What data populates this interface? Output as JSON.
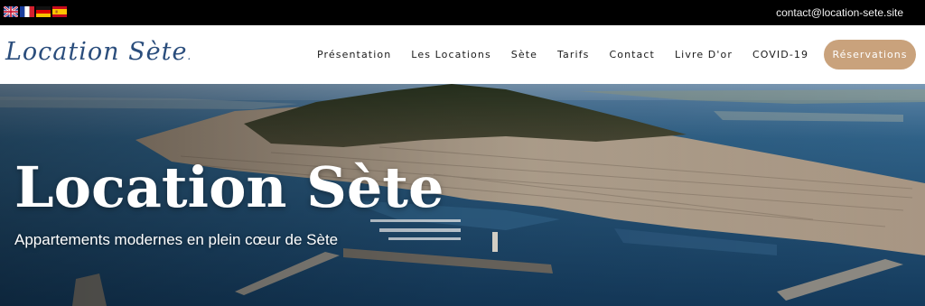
{
  "topbar": {
    "flags": [
      "uk-flag-icon",
      "france-flag-icon",
      "germany-flag-icon",
      "spain-flag-icon"
    ],
    "email": "contact@location-sete.site"
  },
  "header": {
    "logo": "Location Sète",
    "nav": [
      "Présentation",
      "Les Locations",
      "Sète",
      "Tarifs",
      "Contact",
      "Livre D'or",
      "COVID-19"
    ],
    "cta": "Réservations"
  },
  "hero": {
    "title": "Location Sète",
    "subtitle": "Appartements modernes en plein cœur de Sète"
  },
  "colors": {
    "logo": "#2a4d7c",
    "cta_bg": "#c9a27c",
    "sea": "#1f4f7a",
    "hill": "#2d3a24"
  }
}
